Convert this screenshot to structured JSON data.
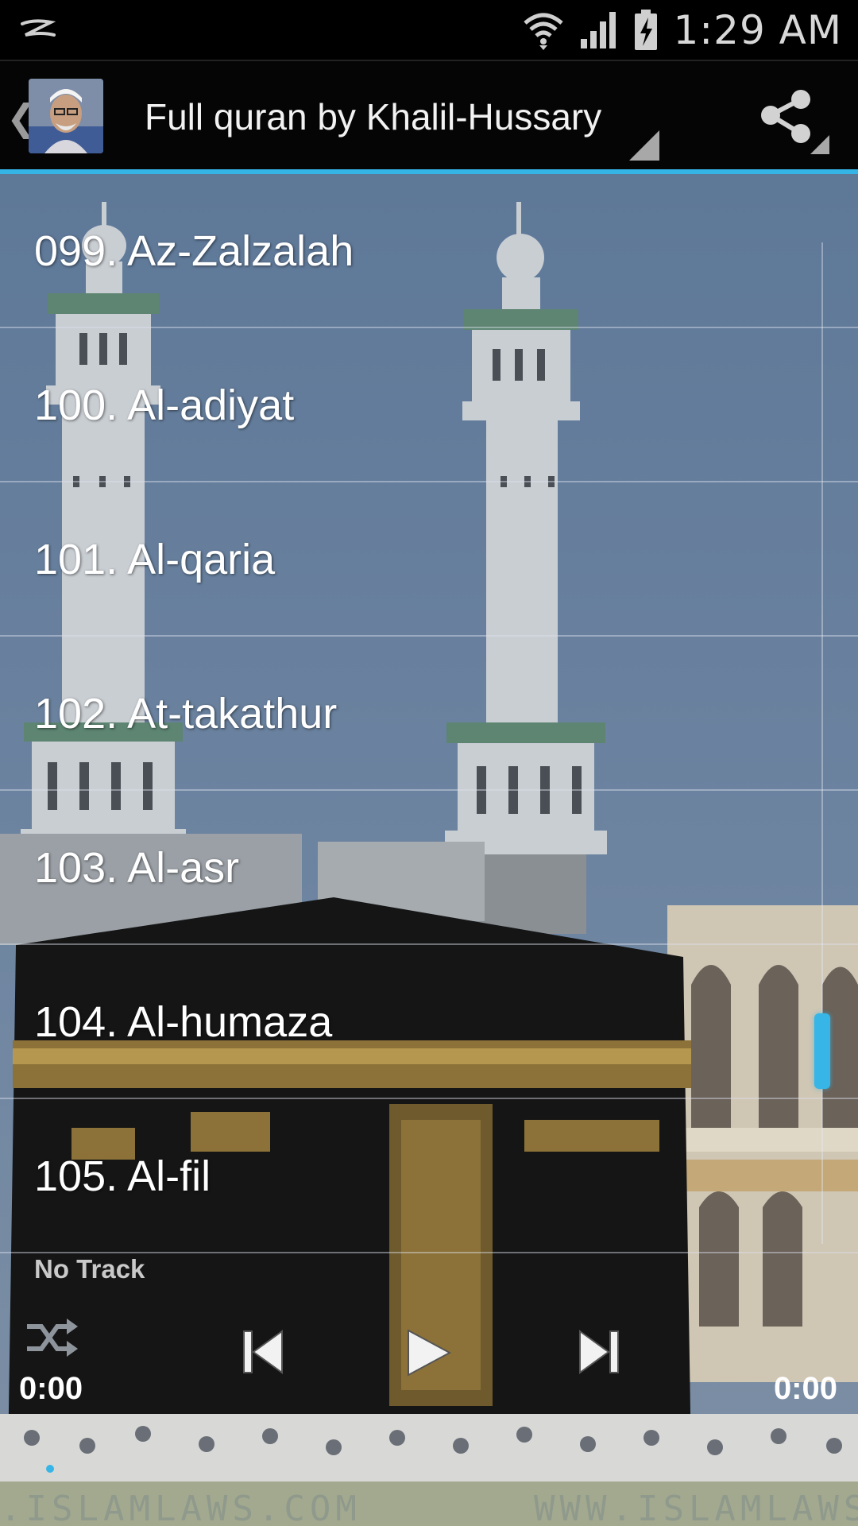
{
  "status_bar": {
    "time": "1:29 AM",
    "icons": [
      "notification-icon",
      "wifi-icon",
      "signal-icon",
      "battery-charging-icon"
    ]
  },
  "action_bar": {
    "title": "Full quran by Khalil-Hussary",
    "icons": [
      "up-chevron-icon",
      "reciter-avatar",
      "dropdown-corner-icon",
      "share-icon"
    ]
  },
  "surah_list": {
    "items": [
      "099. Az-Zalzalah",
      "100. Al-adiyat",
      "101. Al-qaria",
      "102. At-takathur",
      "103. Al-asr",
      "104. Al-humaza",
      "105. Al-fil"
    ]
  },
  "player": {
    "track_name": "No Track",
    "elapsed": "0:00",
    "duration": "0:00",
    "controls": [
      "shuffle-icon",
      "previous-icon",
      "play-icon",
      "next-icon"
    ]
  },
  "watermark": {
    "left": ".ISLAMLAWS.COM",
    "right": "WWW.ISLAMLAWS."
  },
  "colors": {
    "accent": "#35b5e5",
    "sky": "#6e85a1",
    "kaaba": "#141414",
    "kiswa_gold": "#a88a45"
  }
}
